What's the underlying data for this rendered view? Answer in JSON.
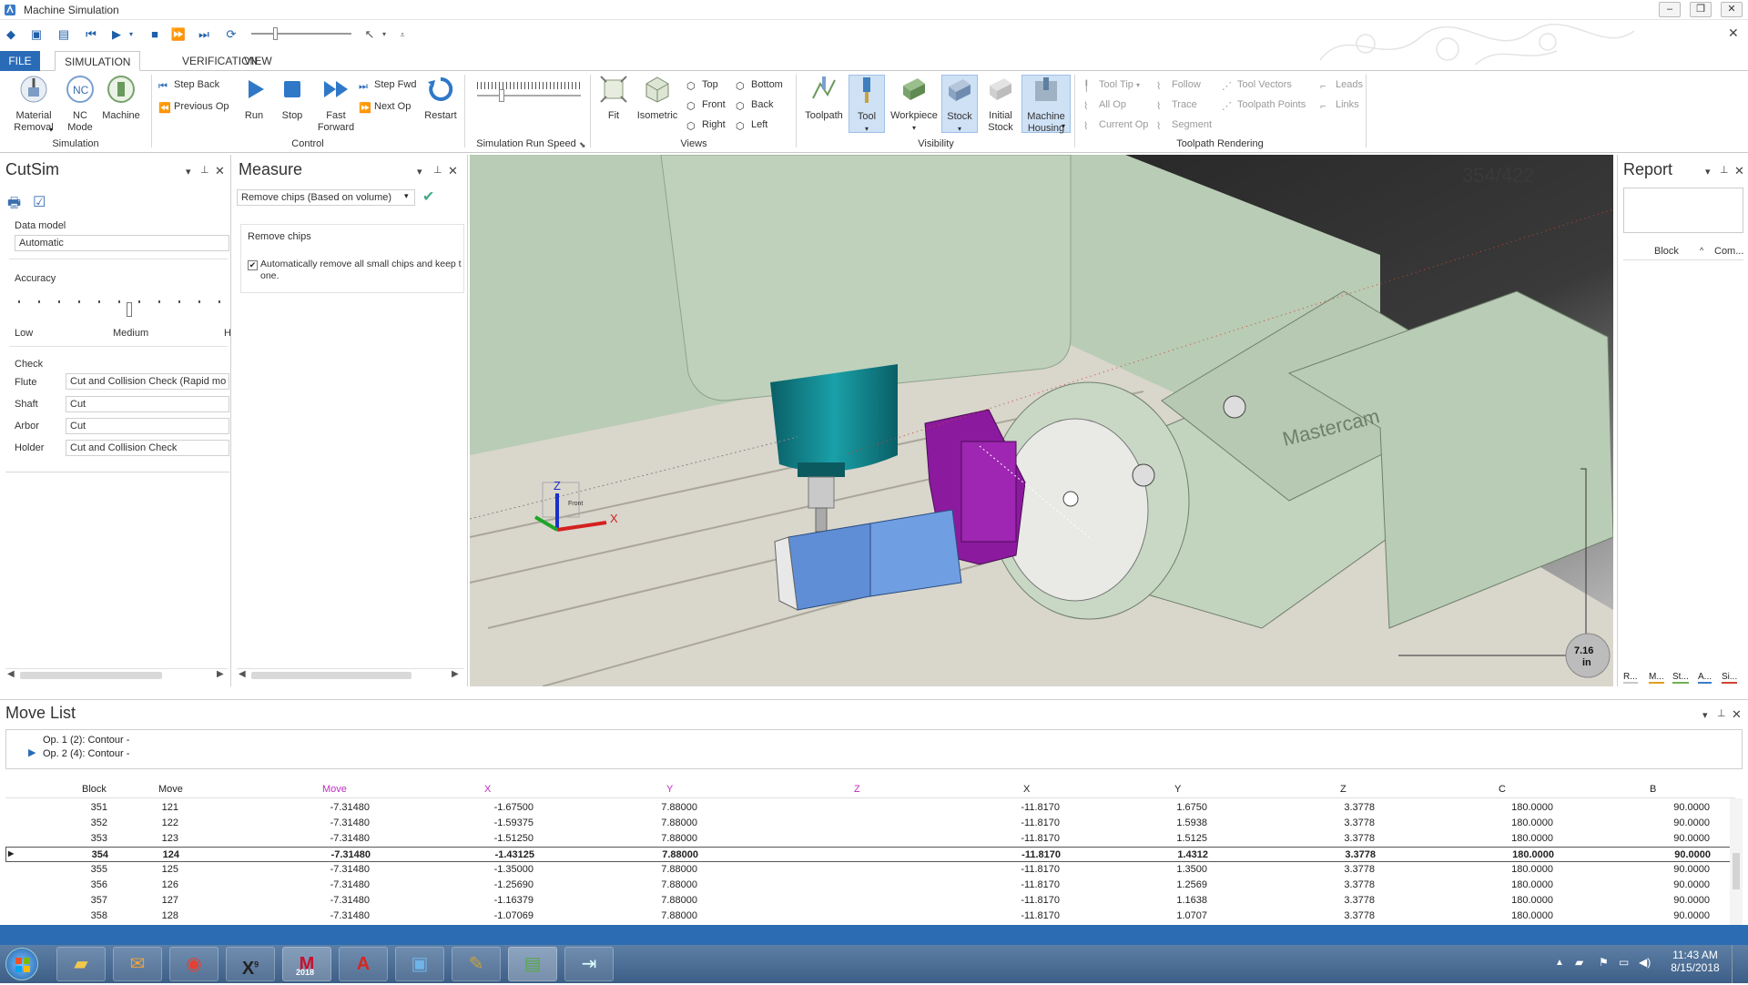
{
  "window": {
    "title": "Machine Simulation"
  },
  "tabs": {
    "file": "FILE",
    "simulation": "SIMULATION",
    "verification": "VERIFICATION",
    "view": "VIEW"
  },
  "ribbon": {
    "simulation_group": {
      "label": "Simulation",
      "material_removal": "Material\nRemoval",
      "nc_mode": "NC\nMode",
      "machine": "Machine",
      "nc_icon_text": "NC"
    },
    "control_group": {
      "label": "Control",
      "step_back": "Step Back",
      "previous_op": "Previous Op",
      "run": "Run",
      "stop": "Stop",
      "fast_forward": "Fast\nForward",
      "step_fwd": "Step Fwd",
      "next_op": "Next Op",
      "restart": "Restart"
    },
    "speed_group": {
      "label": "Simulation Run Speed"
    },
    "views_group": {
      "label": "Views",
      "fit": "Fit",
      "isometric": "Isometric",
      "top": "Top",
      "front": "Front",
      "right": "Right",
      "bottom": "Bottom",
      "back": "Back",
      "left": "Left"
    },
    "visibility_group": {
      "label": "Visibility",
      "toolpath": "Toolpath",
      "tool": "Tool",
      "workpiece": "Workpiece",
      "stock": "Stock",
      "initial_stock": "Initial\nStock",
      "machine_housing": "Machine\nHousing"
    },
    "toolpath_rendering_group": {
      "label": "Toolpath Rendering",
      "tool_tip": "Tool Tip",
      "all_op": "All Op",
      "current_op": "Current Op",
      "follow": "Follow",
      "trace": "Trace",
      "segment": "Segment",
      "tool_vectors": "Tool Vectors",
      "toolpath_points": "Toolpath Points",
      "leads": "Leads",
      "links": "Links"
    }
  },
  "cutsim": {
    "title": "CutSim",
    "data_model_label": "Data model",
    "data_model_value": "Automatic",
    "accuracy_label": "Accuracy",
    "accuracy_low": "Low",
    "accuracy_medium": "Medium",
    "accuracy_high": "H",
    "check_label": "Check",
    "flute_label": "Flute",
    "flute_value": "Cut and Collision Check (Rapid mo",
    "shaft_label": "Shaft",
    "shaft_value": "Cut",
    "arbor_label": "Arbor",
    "arbor_value": "Cut",
    "holder_label": "Holder",
    "holder_value": "Cut and Collision Check"
  },
  "measure": {
    "title": "Measure",
    "dropdown_value": "Remove chips (Based on volume)",
    "section_label": "Remove chips",
    "checkbox_label": "Automatically remove all small chips and keep t",
    "checkbox_label2": "one.",
    "checkbox_checked": true
  },
  "viewport": {
    "counter": "354/422",
    "scale_value": "7.16",
    "scale_unit": "in",
    "brand": "Mastercam",
    "axis_x": "X",
    "axis_z": "Z",
    "cube_face": "Front"
  },
  "report": {
    "title": "Report",
    "col_block": "Block",
    "col_com": "Com...",
    "bottom_tabs": [
      "R...",
      "M...",
      "St...",
      "A...",
      "Si..."
    ]
  },
  "movelist": {
    "title": "Move List",
    "ops": [
      "Op. 1 (2): Contour -",
      "Op. 2 (4): Contour -"
    ],
    "headers": [
      "Block",
      "Move",
      "Move",
      "X",
      "Y",
      "Z",
      "X",
      "Y",
      "Z",
      "C",
      "B"
    ],
    "rows": [
      [
        "351",
        "121",
        "-7.31480",
        "-1.67500",
        "7.88000",
        "-11.8170",
        "1.6750",
        "3.3778",
        "180.0000",
        "90.0000"
      ],
      [
        "352",
        "122",
        "-7.31480",
        "-1.59375",
        "7.88000",
        "-11.8170",
        "1.5938",
        "3.3778",
        "180.0000",
        "90.0000"
      ],
      [
        "353",
        "123",
        "-7.31480",
        "-1.51250",
        "7.88000",
        "-11.8170",
        "1.5125",
        "3.3778",
        "180.0000",
        "90.0000"
      ],
      [
        "354",
        "124",
        "-7.31480",
        "-1.43125",
        "7.88000",
        "-11.8170",
        "1.4312",
        "3.3778",
        "180.0000",
        "90.0000"
      ],
      [
        "355",
        "125",
        "-7.31480",
        "-1.35000",
        "7.88000",
        "-11.8170",
        "1.3500",
        "3.3778",
        "180.0000",
        "90.0000"
      ],
      [
        "356",
        "126",
        "-7.31480",
        "-1.25690",
        "7.88000",
        "-11.8170",
        "1.2569",
        "3.3778",
        "180.0000",
        "90.0000"
      ],
      [
        "357",
        "127",
        "-7.31480",
        "-1.16379",
        "7.88000",
        "-11.8170",
        "1.1638",
        "3.3778",
        "180.0000",
        "90.0000"
      ],
      [
        "358",
        "128",
        "-7.31480",
        "-1.07069",
        "7.88000",
        "-11.8170",
        "1.0707",
        "3.3778",
        "180.0000",
        "90.0000"
      ]
    ],
    "selected_block": "354"
  },
  "taskbar": {
    "time": "11:43 AM",
    "date": "8/15/2018",
    "mastercam_year": "2018",
    "excel_glyph": "X",
    "excel_version": "9"
  },
  "colors": {
    "accent": "#2a6bb8",
    "viewport_bg": "#2e2e2e",
    "machine_green": "#bcd0b8",
    "fixture_purple": "#8b1a9e",
    "stock_blue": "#5f8ed6",
    "spindle_teal": "#0f7f86",
    "move_header_magenta": "#c02cc0"
  }
}
